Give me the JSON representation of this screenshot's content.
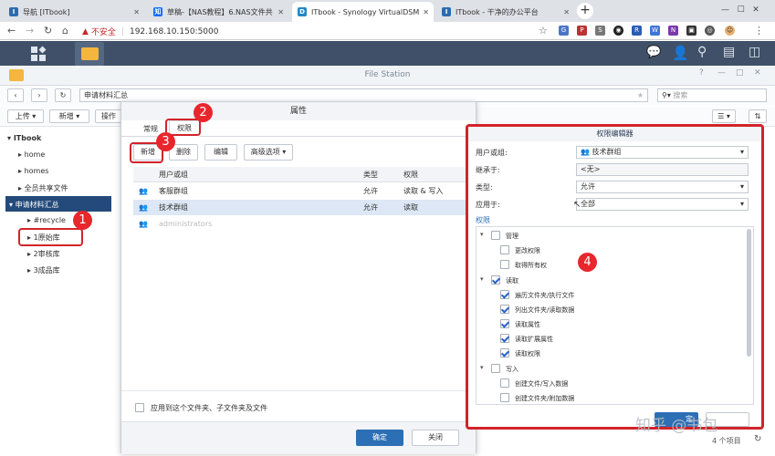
{
  "browser": {
    "tabs": [
      {
        "label": "导航 [ITbook]",
        "icon": "itbook-favicon",
        "color": "#2b6cb0"
      },
      {
        "label": "草稿-【NAS教程】6.NAS文件共",
        "icon": "zhihu-favicon",
        "color": "#0a6cff"
      },
      {
        "label": "ITbook - Synology VirtualDSM",
        "icon": "synology-favicon",
        "color": "#1f88c9"
      },
      {
        "label": "ITbook - 干净的办公平台",
        "icon": "itbook-favicon",
        "color": "#2b6cb0"
      }
    ],
    "insecure_label": "不安全",
    "url": "192.168.10.150:5000"
  },
  "filestation": {
    "title": "File Station",
    "path": "申请材料汇总",
    "search_placeholder": "搜索",
    "toolbar": {
      "upload": "上传",
      "new": "新增",
      "action": "操作"
    },
    "tree": {
      "root": "ITbook",
      "items": [
        "home",
        "homes",
        "全员共享文件",
        "申请材料汇总",
        "#recycle",
        "1原始库",
        "2审核库",
        "3成品库"
      ]
    },
    "item_count": "4 个项目"
  },
  "props": {
    "title": "属性",
    "tabs": [
      "常规",
      "权限"
    ],
    "buttons": {
      "add": "新增",
      "delete": "删除",
      "edit": "编辑",
      "advanced": "高级选项"
    },
    "columns": [
      "用户或组",
      "类型",
      "权限"
    ],
    "rows": [
      {
        "name": "客服群组",
        "type": "允许",
        "perm": "读取 & 写入"
      },
      {
        "name": "技术群组",
        "type": "允许",
        "perm": "读取"
      },
      {
        "name": "administrators",
        "type": "",
        "perm": ""
      }
    ],
    "apply_sub": "应用到这个文件夹、子文件夹及文件",
    "ok": "确定",
    "close": "关闭"
  },
  "perm": {
    "title": "权限编辑器",
    "user_label": "用户或组:",
    "user_value": "技术群组",
    "inherit_label": "继承于:",
    "inherit_value": "<无>",
    "type_label": "类型:",
    "type_value": "允许",
    "apply_label": "应用于:",
    "apply_value": "全部",
    "section": "权限",
    "groups": [
      {
        "label": "管理",
        "checked": false,
        "items": [
          {
            "label": "更改权限",
            "checked": false
          },
          {
            "label": "取得所有权",
            "checked": false
          }
        ]
      },
      {
        "label": "读取",
        "checked": true,
        "items": [
          {
            "label": "遍历文件夹/执行文件",
            "checked": true
          },
          {
            "label": "列出文件夹/读取数据",
            "checked": true
          },
          {
            "label": "读取属性",
            "checked": true
          },
          {
            "label": "读取扩展属性",
            "checked": true
          },
          {
            "label": "读取权限",
            "checked": true
          }
        ]
      },
      {
        "label": "写入",
        "checked": false,
        "items": [
          {
            "label": "创建文件/写入数据",
            "checked": false
          },
          {
            "label": "创建文件夹/附加数据",
            "checked": false
          }
        ]
      }
    ],
    "ok_fragment": "定"
  },
  "annotations": [
    "1",
    "2",
    "3",
    "4"
  ],
  "watermark": "知乎 @书包",
  "colors": {
    "accent": "#2c6fb5",
    "selected": "#234a7a",
    "red": "#d2232a",
    "dsm_bar": "#3f5068"
  }
}
